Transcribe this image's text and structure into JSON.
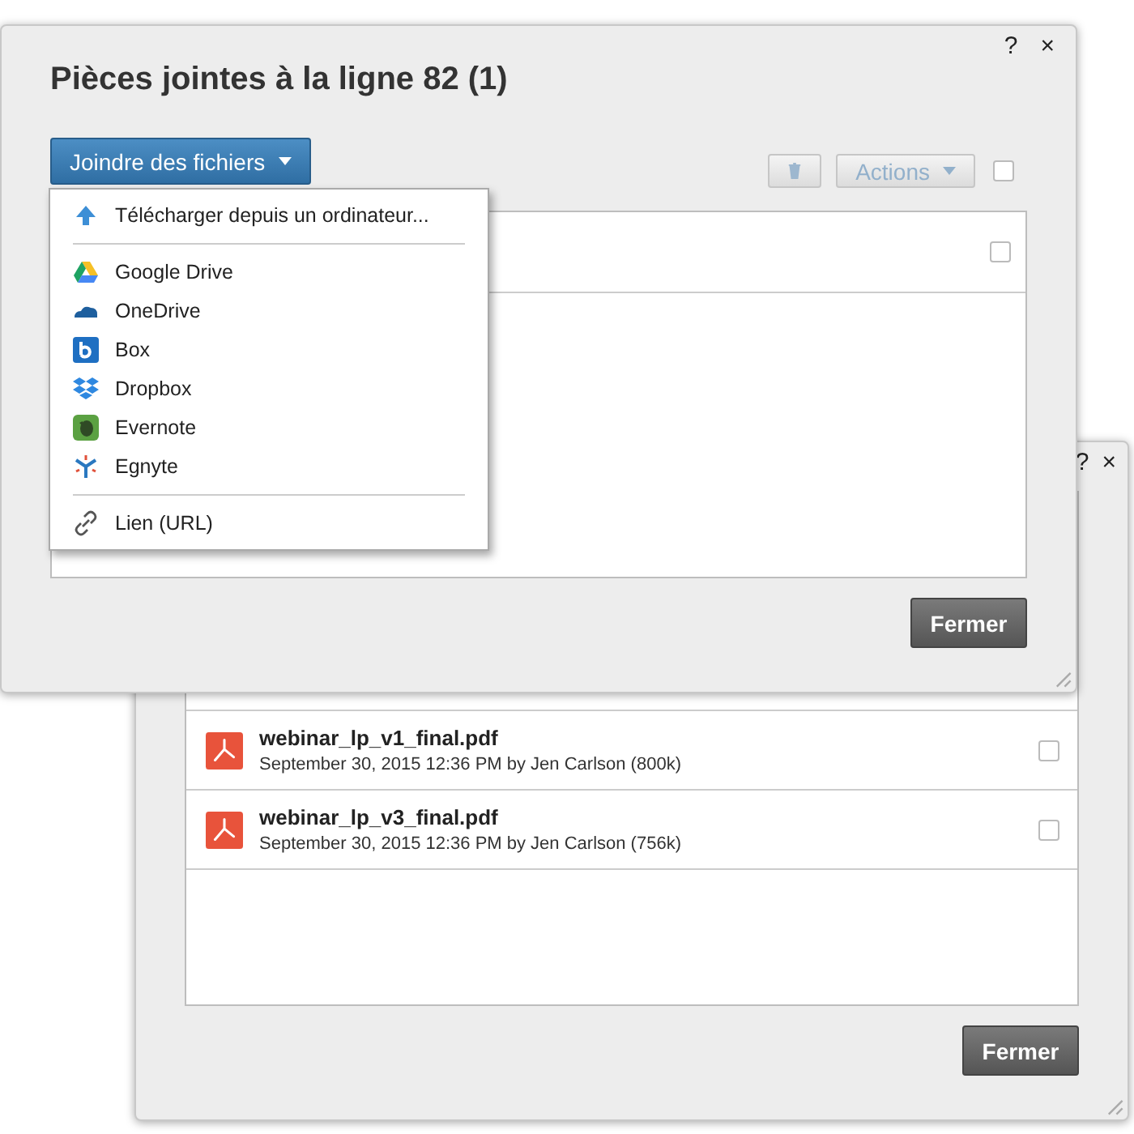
{
  "back_dialog": {
    "help": "?",
    "close": "×",
    "files": [
      {
        "kind": "pdf",
        "name": "webinar_lp_v1_final.pdf",
        "meta": "September 30, 2015 12:36 PM by Jen Carlson (800k)",
        "checked": false
      },
      {
        "kind": "pdf",
        "name": "webinar_lp_v3_final.pdf",
        "meta": "September 30, 2015 12:36 PM by Jen Carlson (756k)",
        "checked": false
      }
    ],
    "close_button": "Fermer"
  },
  "front_dialog": {
    "title": "Pièces jointes à la ligne 82 (1)",
    "help": "?",
    "close": "×",
    "attach_button": "Joindre des fichiers",
    "toolbar": {
      "delete_disabled": true,
      "actions": "Actions",
      "actions_disabled": true,
      "select_all_checked": false
    },
    "rows": [
      {
        "checked": false
      }
    ],
    "close_button": "Fermer",
    "menu": {
      "groups": [
        {
          "items": [
            {
              "kind": "upload",
              "label": "Télécharger depuis un ordinateur..."
            }
          ]
        },
        {
          "items": [
            {
              "kind": "google-drive",
              "label": "Google Drive"
            },
            {
              "kind": "onedrive",
              "label": "OneDrive"
            },
            {
              "kind": "box",
              "label": "Box"
            },
            {
              "kind": "dropbox",
              "label": "Dropbox"
            },
            {
              "kind": "evernote",
              "label": "Evernote"
            },
            {
              "kind": "egnyte",
              "label": "Egnyte"
            }
          ]
        },
        {
          "items": [
            {
              "kind": "link",
              "label": "Lien (URL)"
            }
          ]
        }
      ]
    }
  }
}
